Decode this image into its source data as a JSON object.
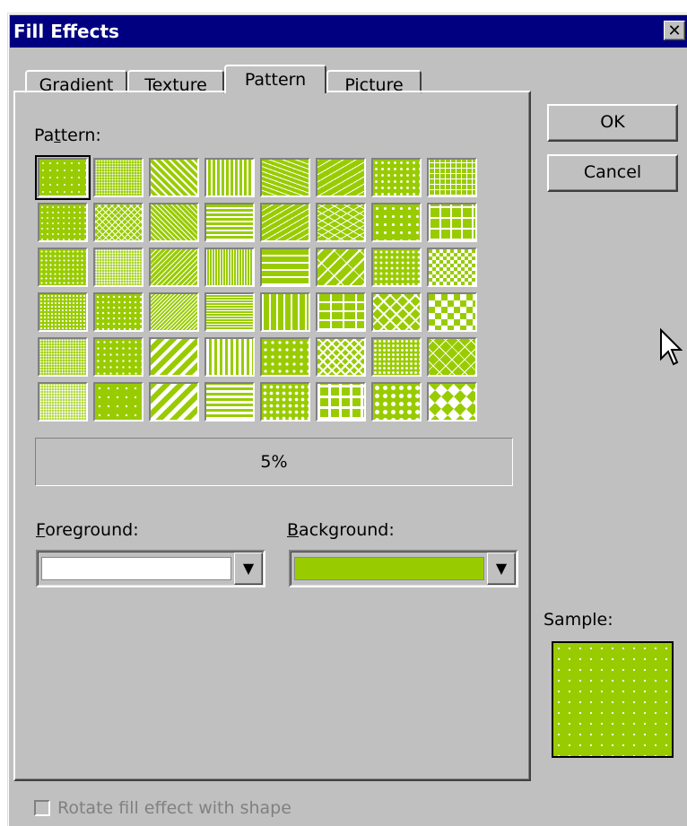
{
  "window": {
    "title": "Fill Effects",
    "close_glyph": "✕"
  },
  "tabs": [
    {
      "label": "Gradient",
      "active": false
    },
    {
      "label": "Texture",
      "active": false
    },
    {
      "label": "Pattern",
      "active": true
    },
    {
      "label": "Picture",
      "active": false
    }
  ],
  "pattern_section": {
    "label_prefix": "Pa",
    "label_mnemonic": "t",
    "label_suffix": "tern:",
    "selected_index": 0,
    "selected_name": "5%",
    "patterns": [
      "5%",
      "light-dots",
      "wide-downward-diagonal",
      "light-vertical",
      "small-dashes",
      "wave",
      "dotted-grid",
      "small-grid",
      "10%",
      "crosshatch-light",
      "light-downward-diagonal",
      "light-horizontal",
      "dashed-upward-diagonal",
      "zigzag",
      "dotted-diamond",
      "large-grid",
      "20%",
      "dense-dots",
      "light-upward-diagonal",
      "narrow-vertical",
      "dashed-horizontal",
      "diagonal-brick",
      "shingle",
      "small-checkerboard",
      "25%",
      "sparse-dots",
      "narrow-upward-diagonal",
      "narrow-horizontal",
      "dashed-vertical",
      "horizontal-brick",
      "weave",
      "large-checkerboard",
      "30%",
      "sparse-dots-2",
      "wide-upward-diagonal",
      "dark-vertical",
      "divot",
      "trellis",
      "sphere-light",
      "outlined-diamond",
      "40%",
      "very-sparse-dots",
      "dark-diagonal",
      "dark-horizontal",
      "confetti",
      "plaid",
      "sphere",
      "solid-diamond"
    ]
  },
  "foreground": {
    "label_mnemonic": "F",
    "label_suffix": "oreground:",
    "value_color": "#ffffff",
    "dropdown_glyph": "▼"
  },
  "background": {
    "label_mnemonic": "B",
    "label_suffix": "ackground:",
    "value_color": "#99cc00",
    "dropdown_glyph": "▼"
  },
  "buttons": {
    "ok_label": "OK",
    "cancel_label": "Cancel"
  },
  "sample": {
    "label": "Sample:"
  },
  "rotate_checkbox": {
    "label": "Rotate fill effect with shape",
    "checked": false,
    "enabled": false
  },
  "colors": {
    "accent": "#99cc00",
    "title_bar": "#000080",
    "dialog": "#c0c0c0",
    "disabled_text": "#808080"
  }
}
